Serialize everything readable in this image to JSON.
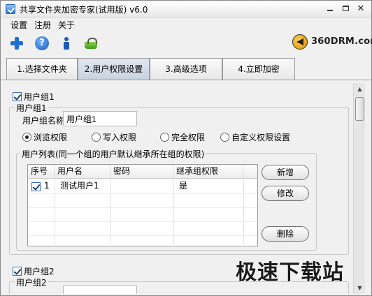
{
  "window": {
    "title": "共享文件夹加密专家(试用版) v6.0"
  },
  "menu": {
    "items": [
      "设置",
      "注册",
      "关于"
    ]
  },
  "logo": {
    "text": "360DRM.com"
  },
  "tabs": [
    "1.选择文件夹",
    "2.用户权限设置",
    "3.高级选项",
    "4.立即加密"
  ],
  "active_tab": 1,
  "group1": {
    "checkbox_label": "用户组1",
    "checked": true,
    "box_title": "用户组1",
    "name_label": "用户组名称",
    "name_value": "用户组1",
    "permissions": [
      "浏览权限",
      "写入权限",
      "完全权限",
      "自定义权限设置"
    ],
    "selected_permission": 0,
    "userlist_title": "用户列表(同一个组的用户默认继承所在组的权限)",
    "columns": [
      "序号",
      "用户名",
      "密码",
      "继承组权限"
    ],
    "rows": [
      {
        "checked": true,
        "index": "1",
        "username": "测试用户1",
        "password": "",
        "inherit": "是"
      }
    ],
    "buttons": {
      "add": "新增",
      "edit": "修改",
      "delete": "删除"
    }
  },
  "group2": {
    "checkbox_label": "用户组2",
    "checked": true,
    "box_title": "用户组2"
  },
  "watermark": "极速下载站",
  "colors": {
    "active_tab": "#c8d2df",
    "panel_bg": "#f0f0f0",
    "accent_blue": "#1f6fd1"
  }
}
